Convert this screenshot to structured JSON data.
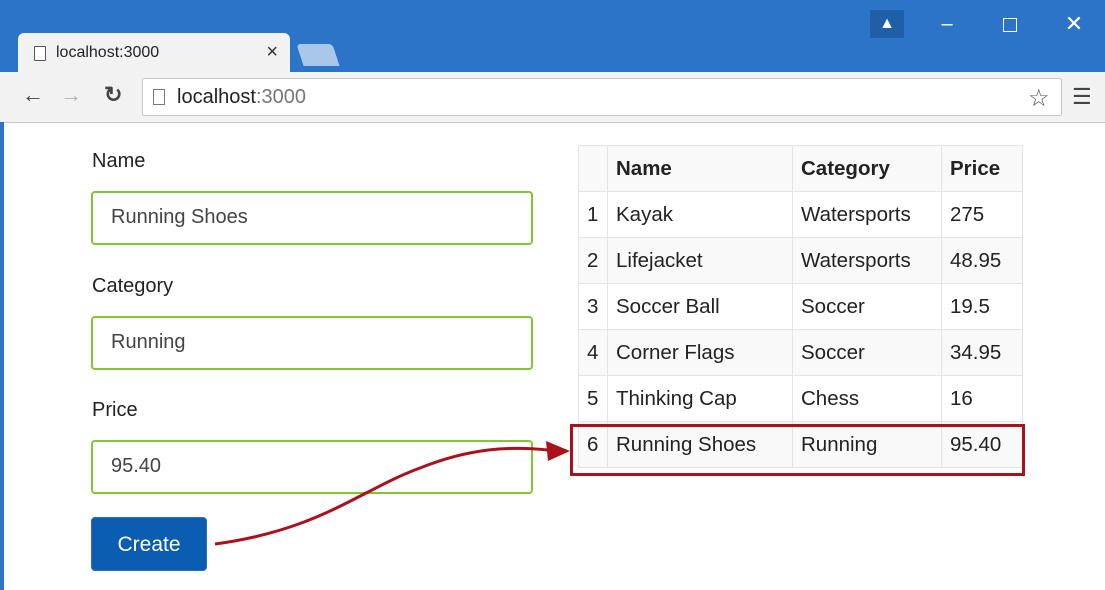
{
  "browser": {
    "tab_title": "localhost:3000",
    "tab_close": "×",
    "url_host": "localhost",
    "url_port": ":3000",
    "icons": {
      "back": "arrow-left",
      "forward": "arrow-right",
      "reload": "reload",
      "bookmark": "star-outline",
      "menu": "hamburger",
      "user": "person",
      "minimize": "minimize",
      "maximize": "maximize",
      "close": "close"
    },
    "colors": {
      "frame": "#2b74c7",
      "toolbar": "#f2f2f2"
    }
  },
  "form": {
    "name_label": "Name",
    "name_value": "Running Shoes",
    "category_label": "Category",
    "category_value": "Running",
    "price_label": "Price",
    "price_value": "95.40",
    "create_label": "Create",
    "colors": {
      "valid_border": "#7fc832",
      "button": "#0b5db2"
    }
  },
  "table": {
    "headers": [
      "",
      "Name",
      "Category",
      "Price"
    ],
    "rows": [
      [
        "1",
        "Kayak",
        "Watersports",
        "275"
      ],
      [
        "2",
        "Lifejacket",
        "Watersports",
        "48.95"
      ],
      [
        "3",
        "Soccer Ball",
        "Soccer",
        "19.5"
      ],
      [
        "4",
        "Corner Flags",
        "Soccer",
        "34.95"
      ],
      [
        "5",
        "Thinking Cap",
        "Chess",
        "16"
      ],
      [
        "6",
        "Running Shoes",
        "Running",
        "95.40"
      ]
    ],
    "highlighted_row": 6,
    "colors": {
      "highlight": "#aa111b",
      "arrow": "#aa111b"
    }
  }
}
